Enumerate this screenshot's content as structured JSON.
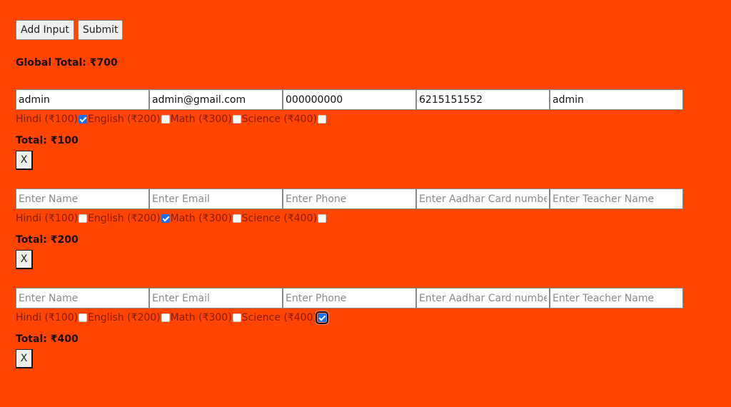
{
  "toolbar": {
    "add_input_label": "Add Input",
    "submit_label": "Submit"
  },
  "global_total": {
    "label": "Global Total: ₹700"
  },
  "entries": [
    {
      "fields": {
        "name": {
          "value": "admin",
          "placeholder": "Enter Name"
        },
        "email": {
          "value": "admin@gmail.com",
          "placeholder": "Enter Email"
        },
        "phone": {
          "value": "000000000",
          "placeholder": "Enter Phone"
        },
        "aadhar": {
          "value": "6215151552",
          "placeholder": "Enter Aadhar Card number"
        },
        "teacher": {
          "value": "admin",
          "placeholder": "Enter Teacher Name"
        }
      },
      "subjects": [
        {
          "label": "Hindi (₹100)",
          "checked": true
        },
        {
          "label": "English (₹200)",
          "checked": false
        },
        {
          "label": "Math (₹300)",
          "checked": false
        },
        {
          "label": "Science (₹400)",
          "checked": false
        }
      ],
      "total": "Total: ₹100",
      "remove_label": "X"
    },
    {
      "fields": {
        "name": {
          "value": "",
          "placeholder": "Enter Name"
        },
        "email": {
          "value": "",
          "placeholder": "Enter Email"
        },
        "phone": {
          "value": "",
          "placeholder": "Enter Phone"
        },
        "aadhar": {
          "value": "",
          "placeholder": "Enter Aadhar Card number"
        },
        "teacher": {
          "value": "",
          "placeholder": "Enter Teacher Name"
        }
      },
      "subjects": [
        {
          "label": "Hindi (₹100)",
          "checked": false
        },
        {
          "label": "English (₹200)",
          "checked": true
        },
        {
          "label": "Math (₹300)",
          "checked": false
        },
        {
          "label": "Science (₹400)",
          "checked": false
        }
      ],
      "total": "Total: ₹200",
      "remove_label": "X"
    },
    {
      "fields": {
        "name": {
          "value": "",
          "placeholder": "Enter Name"
        },
        "email": {
          "value": "",
          "placeholder": "Enter Email"
        },
        "phone": {
          "value": "",
          "placeholder": "Enter Phone"
        },
        "aadhar": {
          "value": "",
          "placeholder": "Enter Aadhar Card number"
        },
        "teacher": {
          "value": "",
          "placeholder": "Enter Teacher Name"
        }
      },
      "subjects": [
        {
          "label": "Hindi (₹100)",
          "checked": false
        },
        {
          "label": "English (₹200)",
          "checked": false
        },
        {
          "label": "Math (₹300)",
          "checked": false
        },
        {
          "label": "Science (₹400)",
          "checked": true,
          "focused": true
        }
      ],
      "total": "Total: ₹400",
      "remove_label": "X"
    }
  ],
  "colors": {
    "background": "#ff4500",
    "label_text": "#8a1c00",
    "checkbox_checked": "#1a6ef0"
  }
}
